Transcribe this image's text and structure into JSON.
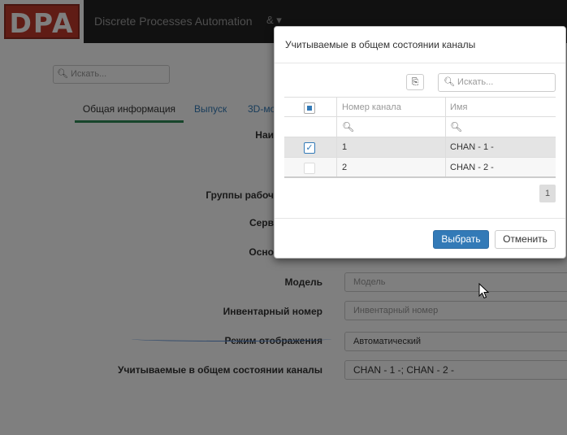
{
  "app": {
    "logo_text": "DPA",
    "title": "Discrete Processes Automation",
    "user_menu": "& ▾"
  },
  "page": {
    "search_placeholder": "Искать...",
    "tabs": [
      "Общая информация",
      "Выпуск",
      "3D-мо"
    ],
    "labels": {
      "name": "Наи",
      "work_groups": "Группы рабоч",
      "server": "Серв",
      "basic": "Осно",
      "model": "Модель",
      "inventory": "Инвентарный номер",
      "display_mode": "Режим отображения",
      "channels": "Учитываемые в общем состоянии каналы"
    },
    "inputs": {
      "model_placeholder": "Модель",
      "inventory_placeholder": "Инвентарный номер",
      "display_mode_value": "Автоматический",
      "channels_value": "CHAN -  1  -; CHAN -  2  -"
    }
  },
  "modal": {
    "title": "Учитываемые в общем состоянии каналы",
    "search_placeholder": "Искать...",
    "columns": [
      "Номер канала",
      "Имя"
    ],
    "rows": [
      {
        "number": "1",
        "name": "CHAN - 1 -",
        "checked": true
      },
      {
        "number": "2",
        "name": "CHAN - 2 -",
        "checked": false
      }
    ],
    "page": "1",
    "select_label": "Выбрать",
    "cancel_label": "Отменить"
  },
  "colors": {
    "accent": "#337ab7",
    "tab_underline": "#2e8b57",
    "logo": "#c0392b",
    "topbar": "#222222"
  }
}
